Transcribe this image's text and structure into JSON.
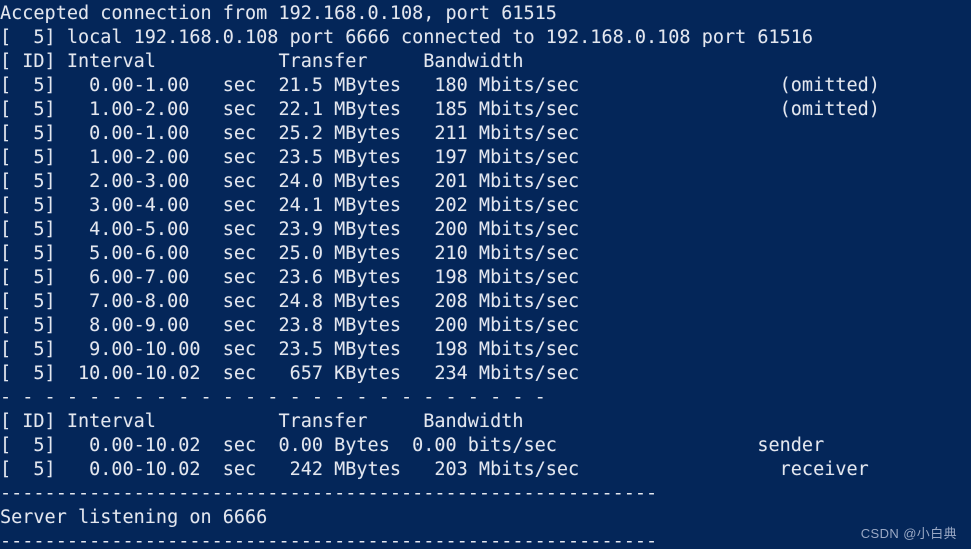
{
  "terminal": {
    "background_color": "#042659",
    "text_color": "#e4e7ee",
    "watermark": "CSDN @小白典",
    "lines": [
      "Accepted connection from 192.168.0.108, port 61515",
      "[  5] local 192.168.0.108 port 6666 connected to 192.168.0.108 port 61516",
      "[ ID] Interval           Transfer     Bandwidth",
      "[  5]   0.00-1.00   sec  21.5 MBytes   180 Mbits/sec                  (omitted)",
      "[  5]   1.00-2.00   sec  22.1 MBytes   185 Mbits/sec                  (omitted)",
      "[  5]   0.00-1.00   sec  25.2 MBytes   211 Mbits/sec",
      "[  5]   1.00-2.00   sec  23.5 MBytes   197 Mbits/sec",
      "[  5]   2.00-3.00   sec  24.0 MBytes   201 Mbits/sec",
      "[  5]   3.00-4.00   sec  24.1 MBytes   202 Mbits/sec",
      "[  5]   4.00-5.00   sec  23.9 MBytes   200 Mbits/sec",
      "[  5]   5.00-6.00   sec  25.0 MBytes   210 Mbits/sec",
      "[  5]   6.00-7.00   sec  23.6 MBytes   198 Mbits/sec",
      "[  5]   7.00-8.00   sec  24.8 MBytes   208 Mbits/sec",
      "[  5]   8.00-9.00   sec  23.8 MBytes   200 Mbits/sec",
      "[  5]   9.00-10.00  sec  23.5 MBytes   198 Mbits/sec",
      "[  5]  10.00-10.02  sec   657 KBytes   234 Mbits/sec",
      "- - - - - - - - - - - - - - - - - - - - - - - - -",
      "[ ID] Interval           Transfer     Bandwidth",
      "[  5]   0.00-10.02  sec  0.00 Bytes  0.00 bits/sec                  sender",
      "[  5]   0.00-10.02  sec   242 MBytes   203 Mbits/sec                  receiver",
      "-----------------------------------------------------------",
      "Server listening on 6666",
      "-----------------------------------------------------------"
    ]
  }
}
